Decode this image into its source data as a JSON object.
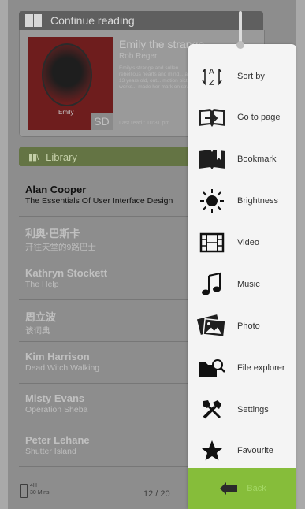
{
  "continue_reading": {
    "header": "Continue reading",
    "book": {
      "title": "Emily the strange",
      "author": "Rob Reger",
      "description": "Emily's strange and sullen... rebellious hearts and mind... around, 13 years old, out... motion picture in works... made her mark on strange...",
      "cover_label": "Emily",
      "storage_badge": "SD",
      "last_read": "Last read : 10:31 pm"
    }
  },
  "library": {
    "header": "Library",
    "items": [
      {
        "author": "Alan Cooper",
        "title": "The Essentials Of User Interface Design",
        "selected": true
      },
      {
        "author": "利奥·巴斯卡",
        "title": "开往天堂的9路巴士"
      },
      {
        "author": "Kathryn Stockett",
        "title": "The Help"
      },
      {
        "author": "周立波",
        "title": "该词典"
      },
      {
        "author": "Kim Harrison",
        "title": "Dead Witch Walking"
      },
      {
        "author": "Misty Evans",
        "title": "Operation Sheba"
      },
      {
        "author": "Peter Lehane",
        "title": "Shutter Island"
      }
    ]
  },
  "status": {
    "battery_hours": "4H",
    "battery_mins": "30 Mins",
    "page": "12 / 20"
  },
  "menu": {
    "items": [
      {
        "label": "Sort by",
        "icon": "sort-az-icon"
      },
      {
        "label": "Go to page",
        "icon": "go-to-page-icon"
      },
      {
        "label": "Bookmark",
        "icon": "bookmark-icon"
      },
      {
        "label": "Brightness",
        "icon": "sun-icon"
      },
      {
        "label": "Video",
        "icon": "film-icon"
      },
      {
        "label": "Music",
        "icon": "music-note-icon"
      },
      {
        "label": "Photo",
        "icon": "photo-icon"
      },
      {
        "label": "File explorer",
        "icon": "folder-search-icon"
      },
      {
        "label": "Settings",
        "icon": "tools-icon"
      },
      {
        "label": "Favourite",
        "icon": "star-icon"
      }
    ],
    "back_label": "Back"
  },
  "colors": {
    "accent_green": "#86bd3a",
    "library_header": "#647444",
    "menu_bg": "#f4f4f4"
  }
}
